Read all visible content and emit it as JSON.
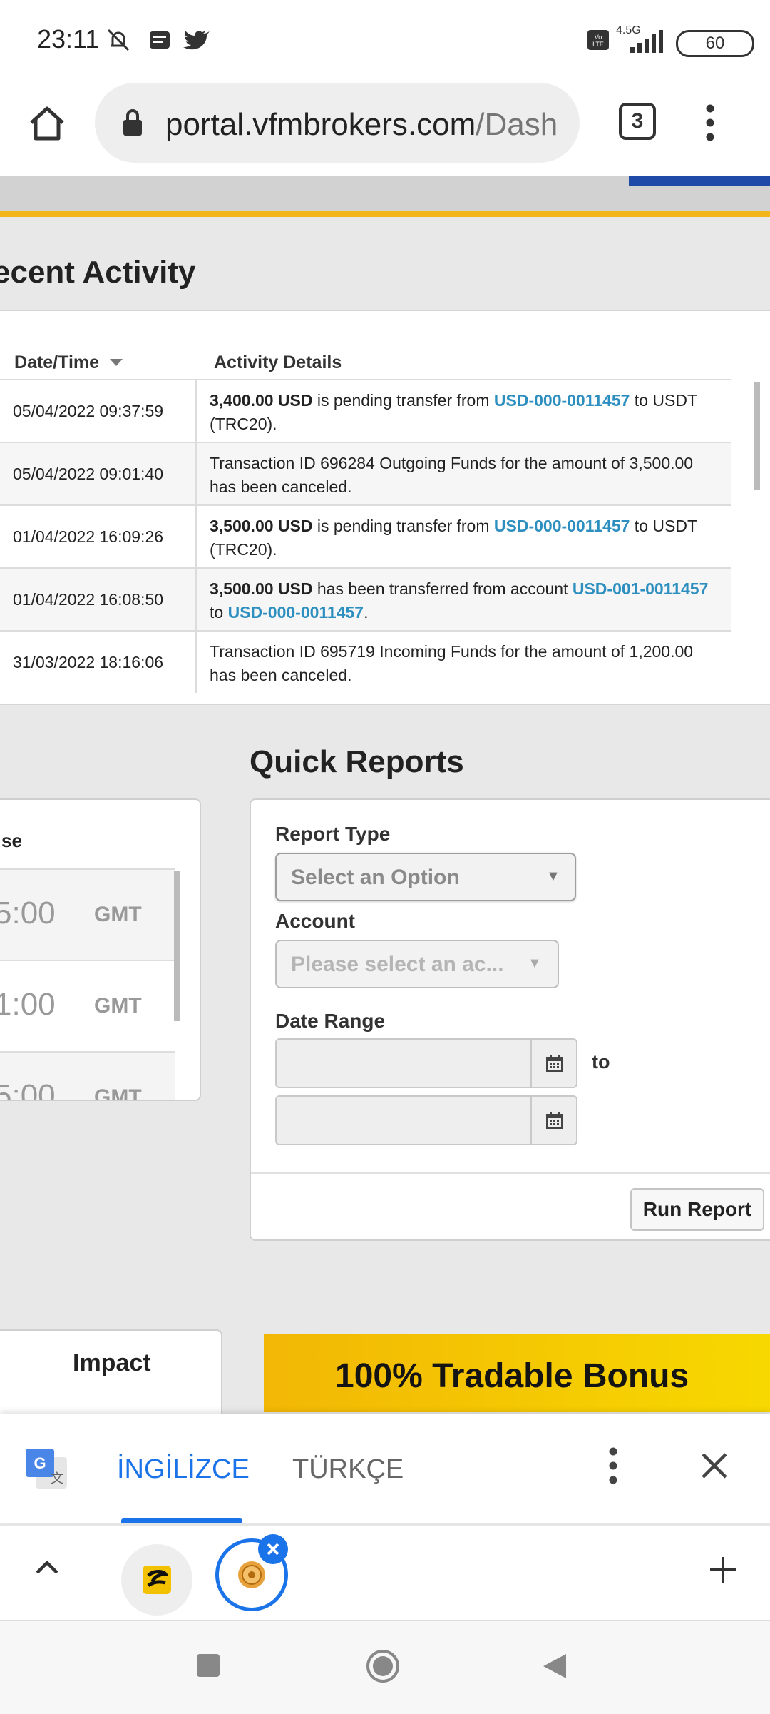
{
  "status_bar": {
    "time": "23:11",
    "network": "4.5G",
    "battery": "60"
  },
  "browser": {
    "url_host": "portal.vfmbrokers.com",
    "url_path": "/Dash",
    "tab_count": "3"
  },
  "recent_activity": {
    "title": "ecent Activity",
    "col_date": "Date/Time",
    "col_details": "Activity Details",
    "rows": [
      {
        "date": "05/04/2022 09:37:59",
        "p1": "3,400.00 USD",
        "p2": " is pending transfer from ",
        "p3": "USD-000-0011457",
        "p4": " to USDT (TRC20)."
      },
      {
        "date": "05/04/2022 09:01:40",
        "text": "Transaction ID 696284 Outgoing Funds for the amount of 3,500.00 has been canceled."
      },
      {
        "date": "01/04/2022 16:09:26",
        "p1": "3,500.00 USD",
        "p2": " is pending transfer from ",
        "p3": "USD-000-0011457",
        "p4": " to USDT (TRC20)."
      },
      {
        "date": "01/04/2022 16:08:50",
        "p1": "3,500.00 USD",
        "p2": " has been transferred from account ",
        "p3": "USD-001-0011457",
        "p4": " to ",
        "p5": "USD-000-0011457",
        "p6": "."
      },
      {
        "date": "31/03/2022 18:16:06",
        "text": "Transaction ID 695719 Incoming Funds for the amount of 1,200.00 has been canceled."
      }
    ]
  },
  "time_panel": {
    "header_partial": "se",
    "rows": [
      {
        "time": "5:00",
        "tz": "GMT"
      },
      {
        "time": "1:00",
        "tz": "GMT"
      },
      {
        "time": "5:00",
        "tz": "GMT"
      }
    ]
  },
  "quick_reports": {
    "title": "Quick Reports",
    "report_type_label": "Report Type",
    "report_type_value": "Select an Option",
    "account_label": "Account",
    "account_value": "Please select an ac...",
    "date_range_label": "Date Range",
    "to_label": "to",
    "run_button": "Run Report"
  },
  "bottom": {
    "impact_label": "Impact",
    "promo_text": "100% Tradable Bonus"
  },
  "translate_bar": {
    "lang_source": "İNGİLİZCE",
    "lang_target": "TÜRKÇE"
  }
}
